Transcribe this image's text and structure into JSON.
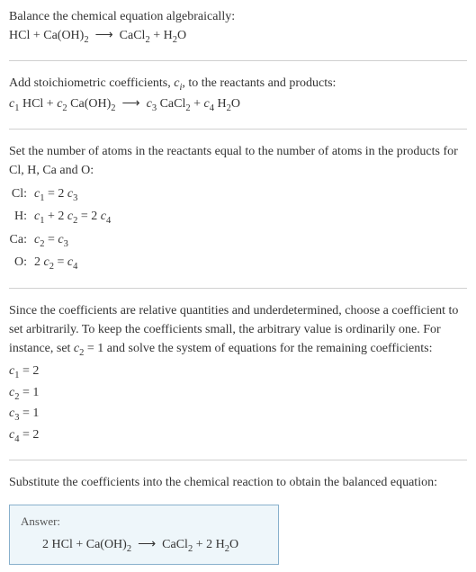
{
  "intro": {
    "line1": "Balance the chemical equation algebraically:",
    "line2_html": "HCl + Ca(OH)<sub>2</sub>&nbsp;&nbsp;⟶&nbsp;&nbsp;CaCl<sub>2</sub> + H<sub>2</sub>O"
  },
  "step1": {
    "text_html": "Add stoichiometric coefficients, <span class='italic'>c<sub>i</sub></span>, to the reactants and products:",
    "eq_html": "<span class='italic'>c</span><sub>1</sub> HCl + <span class='italic'>c</span><sub>2</sub> Ca(OH)<sub>2</sub>&nbsp;&nbsp;⟶&nbsp;&nbsp;<span class='italic'>c</span><sub>3</sub> CaCl<sub>2</sub> + <span class='italic'>c</span><sub>4</sub> H<sub>2</sub>O"
  },
  "step2": {
    "text": "Set the number of atoms in the reactants equal to the number of atoms in the products for Cl, H, Ca and O:",
    "rows": [
      {
        "label": "Cl:",
        "eq_html": "<span class='italic'>c</span><sub>1</sub> = 2 <span class='italic'>c</span><sub>3</sub>"
      },
      {
        "label": "H:",
        "eq_html": "<span class='italic'>c</span><sub>1</sub> + 2 <span class='italic'>c</span><sub>2</sub> = 2 <span class='italic'>c</span><sub>4</sub>"
      },
      {
        "label": "Ca:",
        "eq_html": "<span class='italic'>c</span><sub>2</sub> = <span class='italic'>c</span><sub>3</sub>"
      },
      {
        "label": "O:",
        "eq_html": "2 <span class='italic'>c</span><sub>2</sub> = <span class='italic'>c</span><sub>4</sub>"
      }
    ]
  },
  "step3": {
    "text_html": "Since the coefficients are relative quantities and underdetermined, choose a coefficient to set arbitrarily. To keep the coefficients small, the arbitrary value is ordinarily one. For instance, set <span class='italic'>c</span><sub>2</sub> = 1 and solve the system of equations for the remaining coefficients:",
    "coeffs": [
      "<span class='italic'>c</span><sub>1</sub> = 2",
      "<span class='italic'>c</span><sub>2</sub> = 1",
      "<span class='italic'>c</span><sub>3</sub> = 1",
      "<span class='italic'>c</span><sub>4</sub> = 2"
    ]
  },
  "step4": {
    "text": "Substitute the coefficients into the chemical reaction to obtain the balanced equation:"
  },
  "answer": {
    "label": "Answer:",
    "eq_html": "2 HCl + Ca(OH)<sub>2</sub>&nbsp;&nbsp;⟶&nbsp;&nbsp;CaCl<sub>2</sub> + 2 H<sub>2</sub>O"
  }
}
